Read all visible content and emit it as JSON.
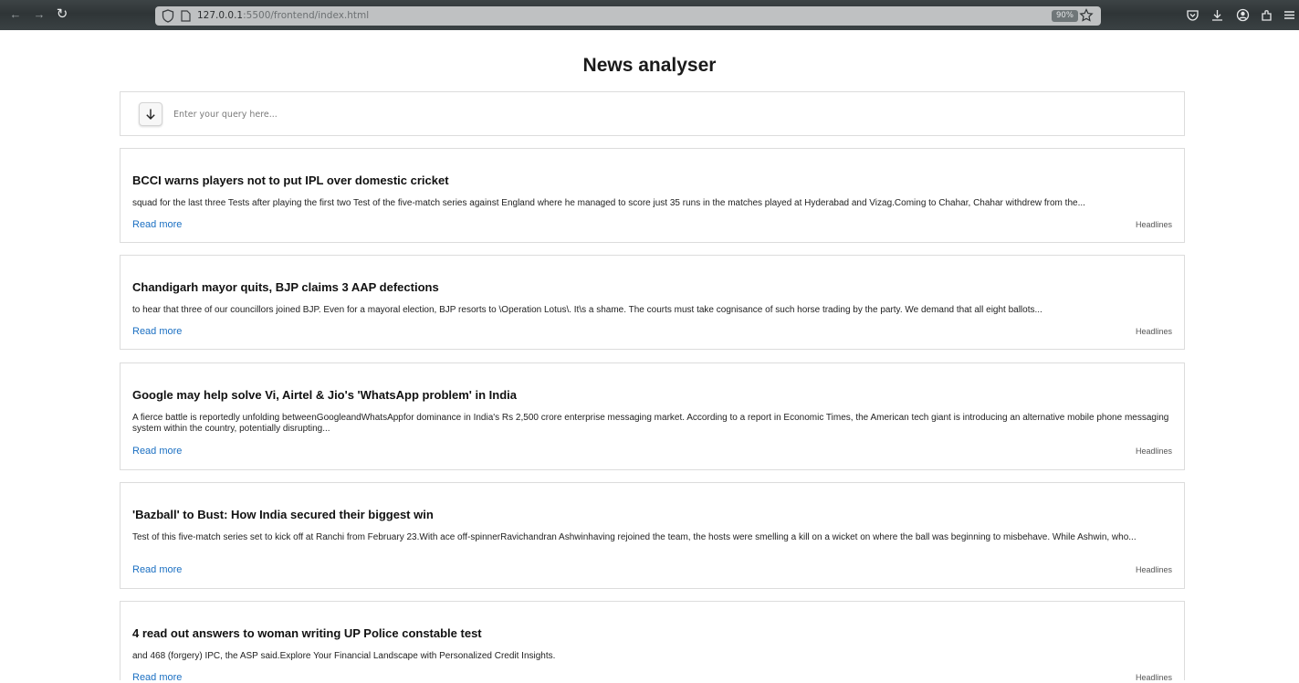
{
  "browser": {
    "url_host": "127.0.0.1",
    "url_rest": ":5500/frontend/index.html",
    "zoom": "90%"
  },
  "page": {
    "title": "News analyser",
    "query_placeholder": "Enter your query here..."
  },
  "articles": [
    {
      "title": "BCCI warns players not to put IPL over domestic cricket",
      "description": "squad for the last three Tests after playing the first two Test of the five-match series against England where he managed to score just 35 runs in the matches played at Hyderabad and Vizag.Coming to Chahar, Chahar withdrew from the...",
      "link_label": "Read more",
      "source": "Headlines"
    },
    {
      "title": "Chandigarh mayor quits, BJP claims 3 AAP defections",
      "description": "to hear that three of our councillors joined BJP. Even for a mayoral election, BJP resorts to \\Operation Lotus\\. It\\s a shame. The courts must take cognisance of such horse trading by the party. We demand that all eight ballots...",
      "link_label": "Read more",
      "source": "Headlines"
    },
    {
      "title": "Google may help solve Vi, Airtel & Jio's 'WhatsApp problem' in India",
      "description": "A fierce battle is reportedly unfolding betweenGoogleandWhatsAppfor dominance in India's Rs 2,500 crore enterprise messaging market. According to a report in Economic Times, the American tech giant is introducing an alternative mobile phone messaging system within the country, potentially disrupting...",
      "link_label": "Read more",
      "source": "Headlines"
    },
    {
      "title": "'Bazball' to Bust: How India secured their biggest win",
      "description": "Test of this five-match series set to kick off at Ranchi from February 23.With ace off-spinnerRavichandran Ashwinhaving rejoined the team, the hosts were smelling a kill on a wicket on where the ball was beginning to misbehave. While Ashwin, who...",
      "link_label": "Read more",
      "source": "Headlines"
    },
    {
      "title": "4 read out answers to woman writing UP Police constable test",
      "description": "and 468 (forgery) IPC, the ASP said.Explore Your Financial Landscape with Personalized Credit Insights.",
      "link_label": "Read more",
      "source": "Headlines"
    }
  ]
}
